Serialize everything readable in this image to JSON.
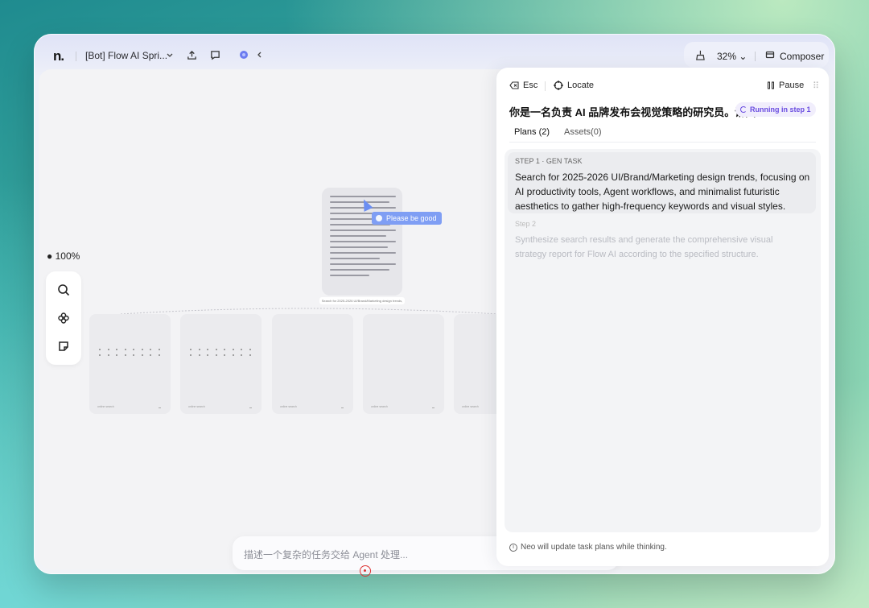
{
  "topbar": {
    "logo": "n.",
    "title": "[Bot] Flow AI Spri...",
    "zoom": "32%",
    "composer_label": "Composer"
  },
  "canvas": {
    "zoom_label": "100%",
    "main_node_caption": "Search for 2025-2026 UI/Brand/Marketing design trends, focus...",
    "tooltip": "Please be good",
    "child_card_foot": "online search"
  },
  "prompt": {
    "placeholder": "描述一个复杂的任务交给 Agent 处理..."
  },
  "panel": {
    "esc_label": "Esc",
    "locate_label": "Locate",
    "pause_label": "Pause",
    "task_title": "你是一名负责 AI 品牌发布会视觉策略的研究员。请围...",
    "status": "Running in step 1",
    "tabs": [
      {
        "label": "Plans (2)",
        "active": true
      },
      {
        "label": "Assets(0)",
        "active": false
      }
    ],
    "steps": [
      {
        "label": "STEP 1 · GEN TASK",
        "text": "Search for 2025-2026 UI/Brand/Marketing design trends, focusing on AI productivity tools, Agent workflows, and minimalist futuristic aesthetics to gather high-frequency keywords and visual styles."
      },
      {
        "label": "Step 2",
        "text": "Synthesize search results and generate the comprehensive visual strategy report for Flow AI according to the specified structure."
      }
    ],
    "note": "Neo will update task plans while thinking."
  }
}
